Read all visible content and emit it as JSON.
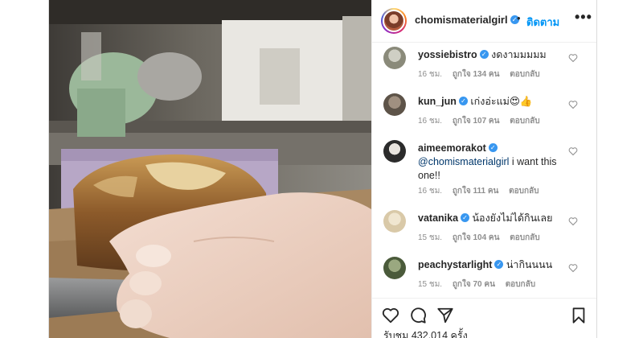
{
  "post": {
    "username": "chomismaterialgirl",
    "separator": "•",
    "follow_label": "ติดตาม",
    "more_label": "•••"
  },
  "comments": [
    {
      "username": "yossiebistro",
      "text": "งดงามมมมม",
      "time": "16 ชม.",
      "likes": "ถูกใจ 134 คน",
      "reply": "ตอบกลับ",
      "avatar_color": "#8a8a7a"
    },
    {
      "username": "kun_jun",
      "text": "เก่งอ่ะแม่😍👍",
      "time": "16 ชม.",
      "likes": "ถูกใจ 107 คน",
      "reply": "ตอบกลับ",
      "avatar_color": "#5d5348"
    },
    {
      "username": "aimeemorakot",
      "mention": "@chomismaterialgirl",
      "text": " i want this one!!",
      "time": "16 ชม.",
      "likes": "ถูกใจ 111 คน",
      "reply": "ตอบกลับ",
      "avatar_color": "#2b2b2b"
    },
    {
      "username": "vatanika",
      "text": "น้องยังไม่ได้กินเลย",
      "time": "15 ชม.",
      "likes": "ถูกใจ 104 คน",
      "reply": "ตอบกลับ",
      "avatar_color": "#d9c9a8"
    },
    {
      "username": "peachystarlight",
      "text": "น่ากินนนน",
      "time": "15 ชม.",
      "likes": "ถูกใจ 70 คน",
      "reply": "ตอบกลับ",
      "avatar_color": "#4a5a3a"
    }
  ],
  "views_text": "รับชม 432,014 ครั้ง",
  "colors": {
    "accent": "#0095f6",
    "verified": "#3897f0",
    "meta": "#8e8e8e"
  }
}
